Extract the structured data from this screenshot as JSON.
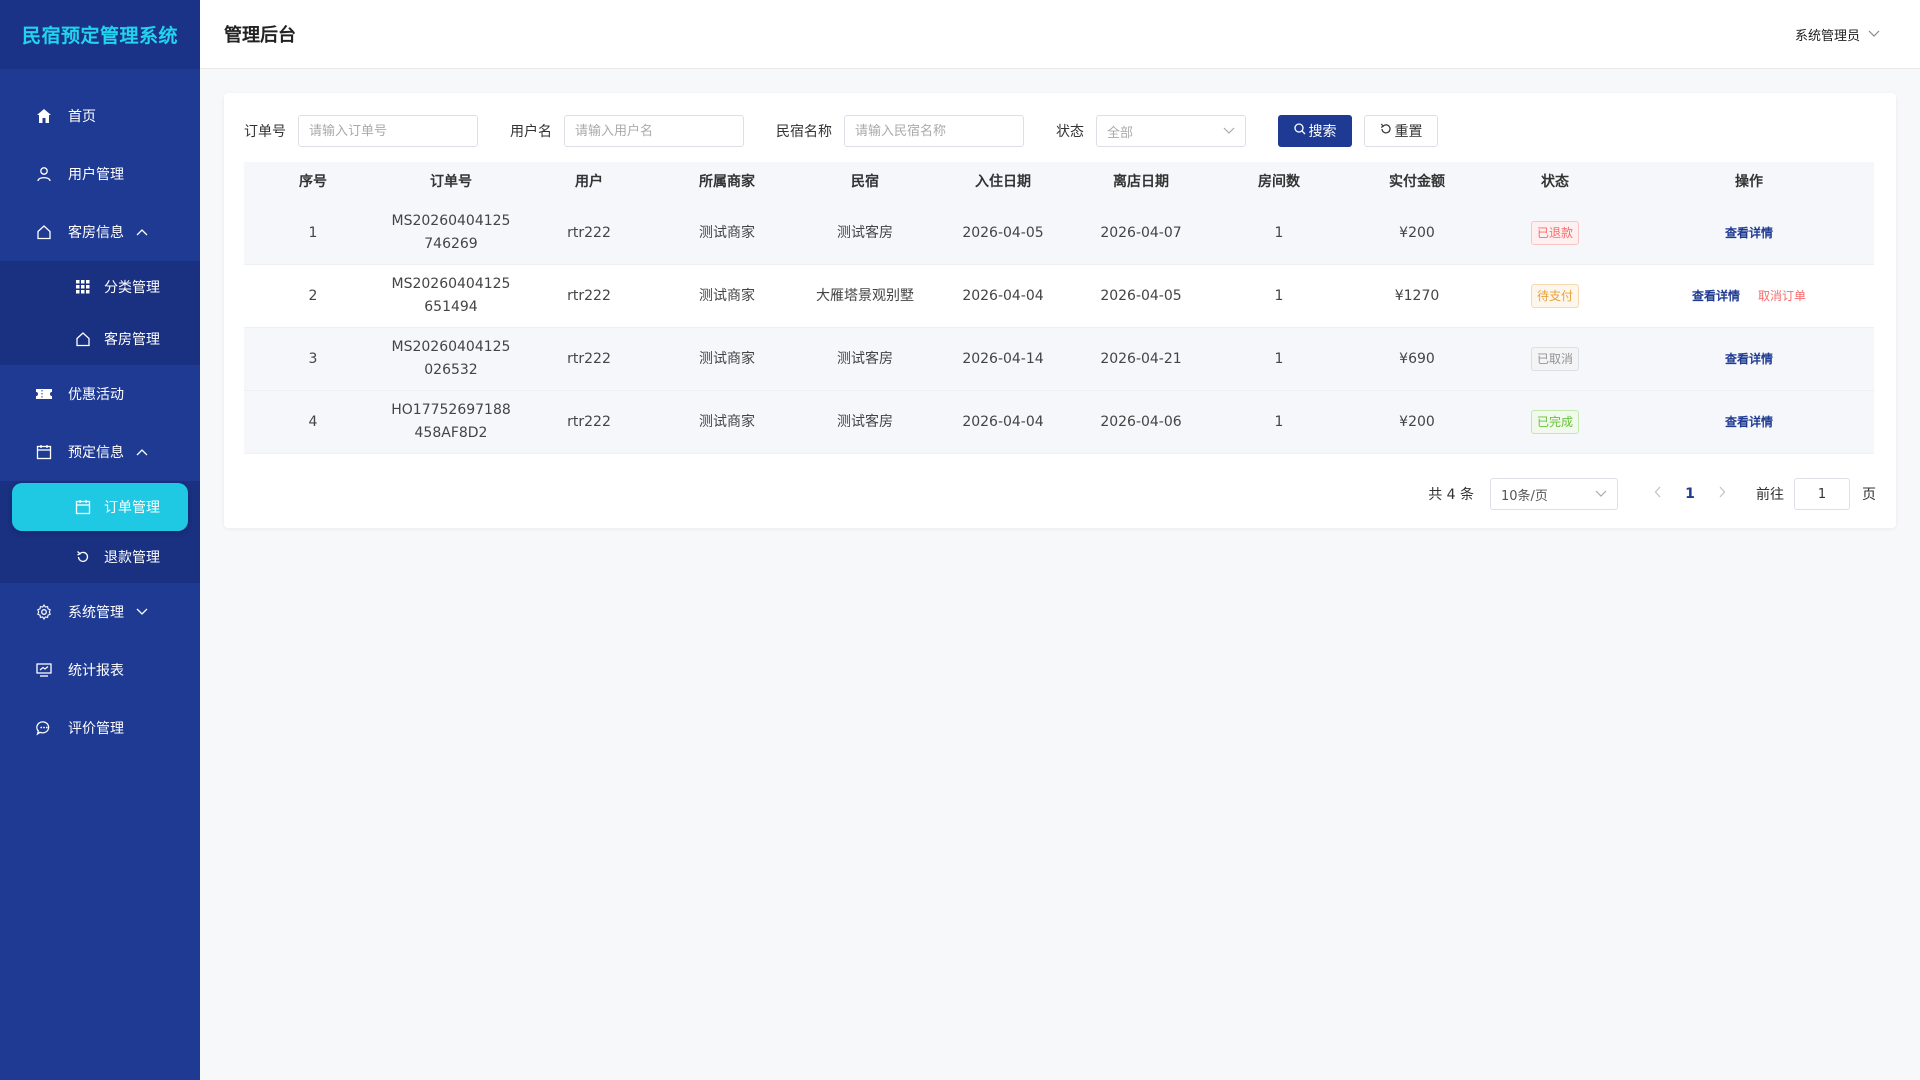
{
  "brand": "民宿预定管理系统",
  "sidebar": {
    "items": [
      {
        "label": "首页"
      },
      {
        "label": "用户管理"
      },
      {
        "label": "客房信息"
      },
      {
        "label": "优惠活动"
      },
      {
        "label": "预定信息"
      },
      {
        "label": "系统管理"
      },
      {
        "label": "统计报表"
      },
      {
        "label": "评价管理"
      }
    ],
    "room_sub": [
      {
        "label": "分类管理"
      },
      {
        "label": "客房管理"
      }
    ],
    "booking_sub": [
      {
        "label": "订单管理"
      },
      {
        "label": "退款管理"
      }
    ]
  },
  "header": {
    "title": "管理后台",
    "user": "系统管理员"
  },
  "filters": {
    "order_label": "订单号",
    "order_placeholder": "请输入订单号",
    "user_label": "用户名",
    "user_placeholder": "请输入用户名",
    "homestay_label": "民宿名称",
    "homestay_placeholder": "请输入民宿名称",
    "status_label": "状态",
    "status_value": "全部",
    "search": "搜索",
    "reset": "重置"
  },
  "table": {
    "columns": [
      "序号",
      "订单号",
      "用户",
      "所属商家",
      "民宿",
      "入住日期",
      "离店日期",
      "房间数",
      "实付金额",
      "状态",
      "操作"
    ],
    "rows": [
      {
        "idx": "1",
        "order": "MS20260404125\n746269",
        "user": "rtr222",
        "merchant": "测试商家",
        "homestay": "测试客房",
        "checkin": "2026-04-05",
        "checkout": "2026-04-07",
        "rooms": "1",
        "amount": "¥200",
        "status": "已退款",
        "view": "查看详情"
      },
      {
        "idx": "2",
        "order": "MS20260404125\n651494",
        "user": "rtr222",
        "merchant": "测试商家",
        "homestay": "大雁塔景观别墅",
        "checkin": "2026-04-04",
        "checkout": "2026-04-05",
        "rooms": "1",
        "amount": "¥1270",
        "status": "待支付",
        "view": "查看详情",
        "cancel": "取消订单"
      },
      {
        "idx": "3",
        "order": "MS20260404125\n026532",
        "user": "rtr222",
        "merchant": "测试商家",
        "homestay": "测试客房",
        "checkin": "2026-04-14",
        "checkout": "2026-04-21",
        "rooms": "1",
        "amount": "¥690",
        "status": "已取消",
        "view": "查看详情"
      },
      {
        "idx": "4",
        "order": "HO17752697188\n458AF8D2",
        "user": "rtr222",
        "merchant": "测试商家",
        "homestay": "测试客房",
        "checkin": "2026-04-04",
        "checkout": "2026-04-06",
        "rooms": "1",
        "amount": "¥200",
        "status": "已完成",
        "view": "查看详情"
      }
    ]
  },
  "pagination": {
    "total": "共 4 条",
    "page_size": "10条/页",
    "current": "1",
    "goto": "前往",
    "goto_value": "1",
    "page_unit": "页"
  },
  "colors": {
    "sidebar": "#1f3a93",
    "accent": "#1fc8e3",
    "brand_text": "#22d3ee"
  }
}
